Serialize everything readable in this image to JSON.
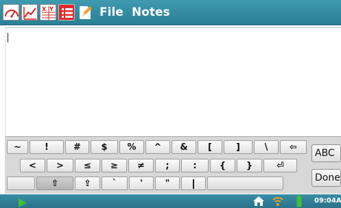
{
  "menu": {
    "file_label": "File",
    "notes_label": "Notes"
  },
  "toolbar_icons": [
    "meter-view-icon",
    "graph-view-icon",
    "table-view-icon",
    "notes-view-icon",
    "pencil-icon"
  ],
  "note": {
    "text": ""
  },
  "keyboard": {
    "row1": [
      "~",
      "!",
      "#",
      "$",
      "%",
      "^",
      "&",
      "[",
      "]",
      "\\",
      "⇦"
    ],
    "row2": [
      "<",
      ">",
      "≤",
      "≥",
      "≠",
      ";",
      ":",
      "{",
      "}",
      "⏎"
    ],
    "row3": [
      "⇧",
      "⇪",
      "`",
      "'",
      "\""
    ],
    "abc_label": "ABC",
    "done_label": "Done"
  },
  "status": {
    "play_icon": "play-icon",
    "home_icon": "home-icon",
    "wifi_icon": "wifi-icon",
    "battery_icon": "battery-icon",
    "time": "09:04A"
  },
  "colors": {
    "topbar": "#2e87a0",
    "statusbar": "#2e7f96",
    "play": "#3fc03a",
    "wifi": "#f0a020",
    "battery": "#3fc03a"
  }
}
